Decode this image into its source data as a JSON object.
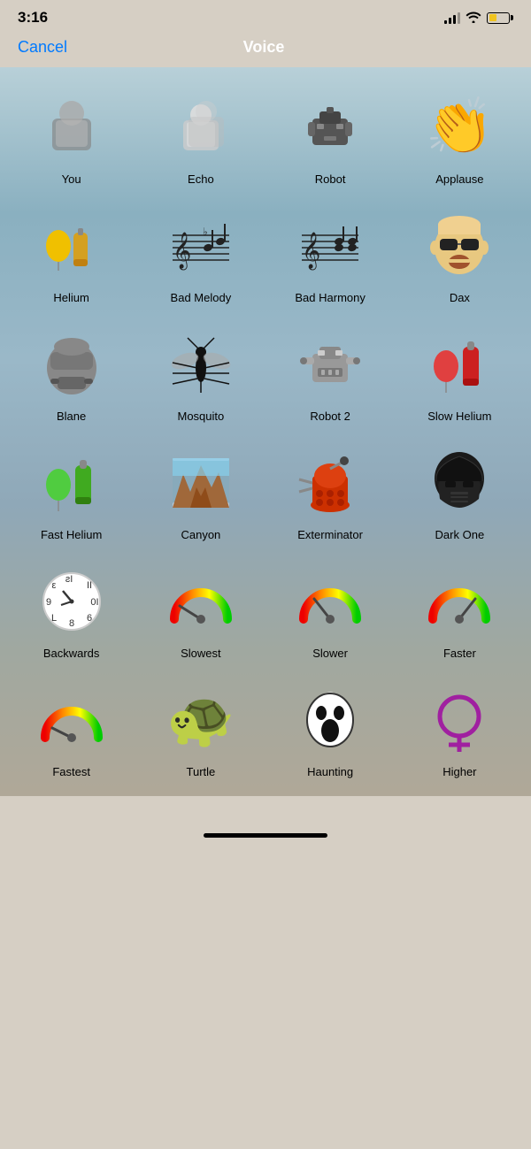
{
  "statusBar": {
    "time": "3:16",
    "signal": "signal",
    "wifi": "wifi",
    "battery": "battery"
  },
  "navBar": {
    "cancelLabel": "Cancel",
    "title": "Voice"
  },
  "voices": [
    {
      "id": "you",
      "label": "You",
      "icon": "person"
    },
    {
      "id": "echo",
      "label": "Echo",
      "icon": "echo"
    },
    {
      "id": "robot",
      "label": "Robot",
      "icon": "robot"
    },
    {
      "id": "applause",
      "label": "Applause",
      "icon": "applause"
    },
    {
      "id": "helium",
      "label": "Helium",
      "icon": "helium"
    },
    {
      "id": "bad-melody",
      "label": "Bad Melody",
      "icon": "notes"
    },
    {
      "id": "bad-harmony",
      "label": "Bad Harmony",
      "icon": "harmony"
    },
    {
      "id": "dax",
      "label": "Dax",
      "icon": "dax"
    },
    {
      "id": "blane",
      "label": "Blane",
      "icon": "blane"
    },
    {
      "id": "mosquito",
      "label": "Mosquito",
      "icon": "mosquito"
    },
    {
      "id": "robot2",
      "label": "Robot 2",
      "icon": "robot2"
    },
    {
      "id": "slow-helium",
      "label": "Slow Helium",
      "icon": "slow-helium"
    },
    {
      "id": "fast-helium",
      "label": "Fast Helium",
      "icon": "fast-helium"
    },
    {
      "id": "canyon",
      "label": "Canyon",
      "icon": "canyon"
    },
    {
      "id": "exterminator",
      "label": "Exterminator",
      "icon": "exterminator"
    },
    {
      "id": "dark-one",
      "label": "Dark One",
      "icon": "dark-one"
    },
    {
      "id": "backwards",
      "label": "Backwards",
      "icon": "backwards"
    },
    {
      "id": "slowest",
      "label": "Slowest",
      "icon": "gauge-slowest"
    },
    {
      "id": "slower",
      "label": "Slower",
      "icon": "gauge-slower"
    },
    {
      "id": "faster",
      "label": "Faster",
      "icon": "gauge-faster"
    },
    {
      "id": "fastest",
      "label": "Fastest",
      "icon": "gauge-fastest"
    },
    {
      "id": "turtle",
      "label": "Turtle",
      "icon": "turtle"
    },
    {
      "id": "haunting",
      "label": "Haunting",
      "icon": "haunting"
    },
    {
      "id": "higher",
      "label": "Higher",
      "icon": "higher"
    }
  ],
  "homeIndicator": "home"
}
